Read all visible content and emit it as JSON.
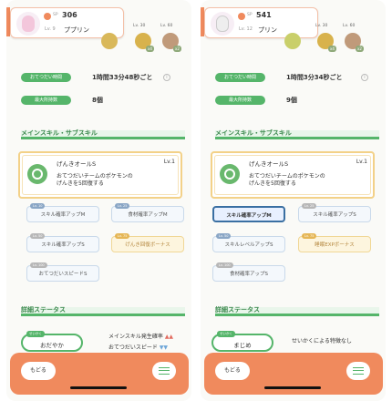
{
  "screens": [
    {
      "header": {
        "cp_label": "SP",
        "cp_value": "306",
        "level": "Lv. 9",
        "name": "ププリン"
      },
      "ingredients": [
        {
          "unlock_label": "",
          "quantity": "",
          "color": "#d9b85a"
        },
        {
          "unlock_label": "Lv. 30",
          "quantity": "x4",
          "color": "#d8b24c"
        },
        {
          "unlock_label": "Lv. 60",
          "quantity": "x2",
          "color": "#c09a7a"
        }
      ],
      "stats": [
        {
          "label": "おてつだい時間",
          "value": "1時間33分48秒ごと"
        },
        {
          "label": "最大所持数",
          "value": "8個"
        }
      ],
      "section_main": "メインスキル・サブスキル",
      "skill": {
        "name": "げんきオールS",
        "level": "Lv.1",
        "description": "おてつだいチームのポケモンの\nげんきを5回復する"
      },
      "subskills": [
        {
          "badge": "Lv. 10",
          "label": "スキル確率アップM"
        },
        {
          "badge": "Lv. 25",
          "label": "食材確率アップM"
        },
        {
          "badge": "Lv. 50",
          "label": "スキル確率アップS"
        },
        {
          "badge": "Lv. 75",
          "label": "げんき回復ボーナス"
        },
        {
          "badge": "Lv. 100",
          "label": "おてつだいスピードS"
        }
      ],
      "section_detail": "詳細ステータス",
      "nature": {
        "tag": "せいかく",
        "value": "おだやか"
      },
      "effects": [
        {
          "label": "メインスキル発生確率",
          "marks": "▲▲"
        },
        {
          "label": "おてつだいスピード",
          "marks": "▼▼"
        }
      ],
      "footer": {
        "back": "もどる"
      }
    },
    {
      "header": {
        "cp_label": "SP",
        "cp_value": "541",
        "level": "Lv. 12",
        "name": "プリン"
      },
      "ingredients": [
        {
          "unlock_label": "",
          "quantity": "",
          "color": "#c9cf6a"
        },
        {
          "unlock_label": "Lv. 30",
          "quantity": "x4",
          "color": "#d8b24c"
        },
        {
          "unlock_label": "Lv. 60",
          "quantity": "x2",
          "color": "#c09a7a"
        }
      ],
      "stats": [
        {
          "label": "おてつだい時間",
          "value": "1時間3分34秒ごと"
        },
        {
          "label": "最大所持数",
          "value": "9個"
        }
      ],
      "section_main": "メインスキル・サブスキル",
      "skill": {
        "name": "げんきオールS",
        "level": "Lv.1",
        "description": "おてつだいチームのポケモンの\nげんきを5回復する"
      },
      "subskills": [
        {
          "badge": "",
          "label": "スキル確率アップM"
        },
        {
          "badge": "Lv. 25",
          "label": "スキル確率アップS"
        },
        {
          "badge": "Lv. 50",
          "label": "スキルレベルアップS"
        },
        {
          "badge": "Lv. 75",
          "label": "睡眠EXPボーナス"
        },
        {
          "badge": "Lv. 100",
          "label": "食材確率アップS"
        }
      ],
      "section_detail": "詳細ステータス",
      "nature": {
        "tag": "せいかく",
        "value": "まじめ"
      },
      "effects": [
        {
          "label": "せいかくによる特徴なし",
          "marks": ""
        }
      ],
      "footer": {
        "back": "もどる"
      }
    }
  ]
}
